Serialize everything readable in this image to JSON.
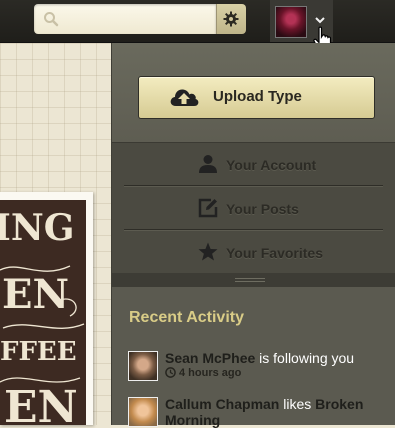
{
  "search": {
    "placeholder": "",
    "value": ""
  },
  "topbar": {
    "settings_icon": "gear-icon",
    "user_menu_icon": "chevron-down-icon"
  },
  "menu": {
    "upload_label": "Upload Type",
    "items": [
      {
        "label": "Your Account",
        "icon": "person-icon"
      },
      {
        "label": "Your Posts",
        "icon": "edit-icon"
      },
      {
        "label": "Your Favorites",
        "icon": "star-icon"
      }
    ]
  },
  "activity": {
    "title": "Recent Activity",
    "items": [
      {
        "user": "Sean McPhee",
        "action": "is following you",
        "time": "4 hours ago"
      },
      {
        "user": "Callum Chapman",
        "action": "likes",
        "target": "Broken Morning"
      }
    ]
  },
  "poster": {
    "lines": [
      "ING",
      "EN",
      "FFEE",
      "EN"
    ]
  },
  "colors": {
    "accent": "#d9cc87",
    "panel": "#5f5e53",
    "topbar": "#1f1e1a",
    "button": "#e6dca8"
  }
}
